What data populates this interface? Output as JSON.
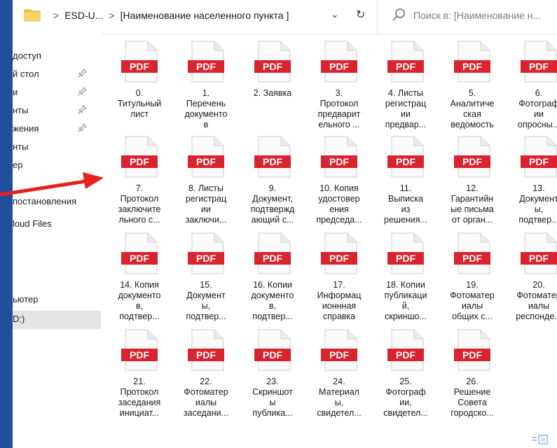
{
  "address_bar": {
    "crumbs": [
      "ESD-U...",
      "[Наименование населенного пункта ]"
    ],
    "search_placeholder": "Поиск в: [Наименование н..."
  },
  "nav": {
    "items": [
      {
        "label": "доступ",
        "pinned": false
      },
      {
        "label": "й стол",
        "pinned": true
      },
      {
        "label": "и",
        "pinned": true
      },
      {
        "label": "нты",
        "pinned": true
      },
      {
        "label": "жения",
        "pinned": true
      },
      {
        "label": "нты",
        "pinned": false
      },
      {
        "label": "ер",
        "pinned": false
      },
      {
        "label": "постановления",
        "pinned": false
      },
      {
        "label": "loud Files",
        "pinned": false
      },
      {
        "label": "ьютер",
        "pinned": false
      },
      {
        "label": "D:)",
        "pinned": false,
        "selected": true
      }
    ]
  },
  "files": [
    {
      "icon_label": "PDF",
      "name": "0.\nТитульный\nлист"
    },
    {
      "icon_label": "PDF",
      "name": "1.\nПеречень\nдокументо\nв"
    },
    {
      "icon_label": "PDF",
      "name": "2. Заявка"
    },
    {
      "icon_label": "PDF",
      "name": "3.\nПротокол\nпредварит\nельного ..."
    },
    {
      "icon_label": "PDF",
      "name": "4. Листы\nрегистрац\nии\nпредвар..."
    },
    {
      "icon_label": "PDF",
      "name": "5.\nАналитиче\nская\nведомость"
    },
    {
      "icon_label": "PDF",
      "name": "6.\nФотограф\nии\nопросны..."
    },
    {
      "icon_label": "PDF",
      "name": "7.\nПротокол\nзаключите\nльного с..."
    },
    {
      "icon_label": "PDF",
      "name": "8. Листы\nрегистрац\nии\nзаключи..."
    },
    {
      "icon_label": "PDF",
      "name": "9.\nДокумент,\nподтвержд\nающий с..."
    },
    {
      "icon_label": "PDF",
      "name": "10. Копия\nудостовер\nения\nпредседа..."
    },
    {
      "icon_label": "PDF",
      "name": "11.\nВыписка\nиз\nрешения..."
    },
    {
      "icon_label": "PDF",
      "name": "12.\nГарантийн\nые письма\nот орган..."
    },
    {
      "icon_label": "PDF",
      "name": "13.\nДокумент\nы,\nподтвер..."
    },
    {
      "icon_label": "PDF",
      "name": "14. Копия\nдокументо\nв,\nподтвер..."
    },
    {
      "icon_label": "PDF",
      "name": "15.\nДокумент\nы,\nподтвер..."
    },
    {
      "icon_label": "PDF",
      "name": "16. Копии\nдокументо\nв,\nподтвер..."
    },
    {
      "icon_label": "PDF",
      "name": "17.\nИнформац\nионнная\nсправка"
    },
    {
      "icon_label": "PDF",
      "name": "18. Копии\nпубликаци\nй,\nскриншо..."
    },
    {
      "icon_label": "PDF",
      "name": "19.\nФотоматер\nиалы\nобщих с..."
    },
    {
      "icon_label": "PDF",
      "name": "20.\nФотоматер\nиалы\nреспонде..."
    },
    {
      "icon_label": "PDF",
      "name": "21.\nПротокол\nзаседания\nинициат..."
    },
    {
      "icon_label": "PDF",
      "name": "22.\nФотоматер\nиалы\nзаседани..."
    },
    {
      "icon_label": "PDF",
      "name": "23.\nСкриншот\nы\nпублика..."
    },
    {
      "icon_label": "PDF",
      "name": "24.\nМатериал\nы,\nсвидетел..."
    },
    {
      "icon_label": "PDF",
      "name": "25.\nФотограф\nии,\nсвидетел..."
    },
    {
      "icon_label": "PDF",
      "name": "26.\nРешение\nСовета\nгородско..."
    }
  ],
  "colors": {
    "background": "#1f4f9c",
    "pdf_red": "#d9232e",
    "arrow_red": "#e8201c",
    "folder_yellow": "#f4c542"
  }
}
